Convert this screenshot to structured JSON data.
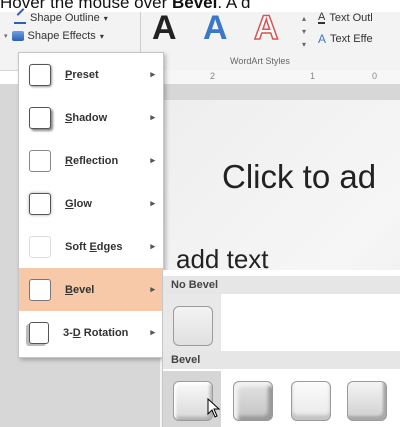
{
  "caption": {
    "lead": "Hover the mouse over ",
    "bold": "Bevel",
    "tail": ". A d"
  },
  "ribbon": {
    "shape_outline": "Shape Outline",
    "shape_effects": "Shape Effects",
    "wordart_group": "WordArt Styles",
    "wordart_letters": [
      "A",
      "A",
      "A"
    ],
    "text_outline": "Text Outl",
    "text_effects": "Text Effe"
  },
  "ruler": {
    "marks": [
      "2",
      "1",
      "0"
    ]
  },
  "slide": {
    "title": "Click to ad",
    "subtitle": "add text"
  },
  "menu": {
    "items": [
      {
        "label": "Preset",
        "key": "P"
      },
      {
        "label": "Shadow",
        "key": "S"
      },
      {
        "label": "Reflection",
        "key": "R"
      },
      {
        "label": "Glow",
        "key": "G"
      },
      {
        "label": "Soft Edges",
        "key": "E"
      },
      {
        "label": "Bevel",
        "key": "B"
      },
      {
        "label": "3-D Rotation",
        "key": "D"
      }
    ],
    "highlighted": "Bevel",
    "highlight_color": "#f7c9a9"
  },
  "submenu": {
    "no_bevel_header": "No Bevel",
    "bevel_header": "Bevel"
  }
}
